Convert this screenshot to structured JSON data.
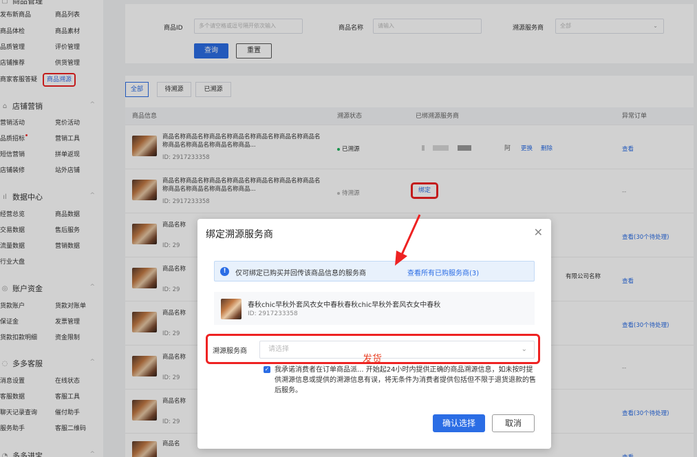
{
  "sidebar": {
    "s0": {
      "title": "商品管理",
      "items": [
        [
          "发布新商品",
          "商品列表"
        ],
        [
          "商品体检",
          "商品素材"
        ],
        [
          "品质管理",
          "评价管理"
        ],
        [
          "店铺推荐",
          "供货管理"
        ],
        [
          "商家客服答疑",
          "商品溯源"
        ]
      ]
    },
    "s1": {
      "title": "店铺营销",
      "items": [
        [
          "营销活动",
          "竞价活动"
        ],
        [
          "品质招标",
          "营销工具"
        ],
        [
          "短信营销",
          "拼单返现"
        ],
        [
          "店铺装修",
          "站外店铺"
        ]
      ]
    },
    "s2": {
      "title": "数据中心",
      "items": [
        [
          "经营总览",
          "商品数据"
        ],
        [
          "交易数据",
          "售后服务"
        ],
        [
          "流量数据",
          "营销数据"
        ],
        [
          "行业大盘",
          ""
        ]
      ]
    },
    "s3": {
      "title": "账户资金",
      "items": [
        [
          "货款账户",
          "货款对账单"
        ],
        [
          "保证金",
          "发票管理"
        ],
        [
          "货款扣款明细",
          "资金限制"
        ]
      ]
    },
    "s4": {
      "title": "多多客服",
      "items": [
        [
          "消息设置",
          "在线状态"
        ],
        [
          "客服数据",
          "客服工具"
        ],
        [
          "聊天记录查询",
          "催付助手"
        ],
        [
          "服务助手",
          "客服二维码"
        ]
      ]
    },
    "s5": {
      "title": "多多进宝"
    }
  },
  "filter": {
    "id_label": "商品ID",
    "id_placeholder": "多个请空格或逗号隔开依次输入",
    "name_label": "商品名称",
    "name_placeholder": "请输入",
    "svc_label": "溯源服务商",
    "svc_value": "全部",
    "search": "查询",
    "reset": "重置"
  },
  "tabs": [
    "全部",
    "待溯源",
    "已溯源"
  ],
  "table": {
    "headers": [
      "商品信息",
      "溯源状态",
      "已绑溯源服务商",
      "异常订单"
    ],
    "rows": [
      {
        "name": "商品名称商品名称商品名称商品名称商品名称商品名称商品名称商品名称商品名称商品名称商品...",
        "id": "ID: 2917233358",
        "status": "已溯源",
        "svc_change": "更换",
        "svc_delete": "删除",
        "op": "查看"
      },
      {
        "name": "商品名称商品名称商品名称商品名称商品名称商品名称商品名称商品名称商品名称商品名称商品...",
        "id": "ID: 2917233358",
        "status": "待溯源",
        "bind": "绑定",
        "op": "--"
      },
      {
        "name": "商品名称",
        "id": "ID: 29",
        "op": "查看(30个待处理)"
      },
      {
        "name": "商品名称",
        "id": "ID: 29",
        "svc": "有限公司名称",
        "op": "查看"
      },
      {
        "name": "商品名称",
        "id": "ID: 29",
        "op": "查看(30个待处理)"
      },
      {
        "name": "商品名称",
        "id": "ID: 29",
        "op": "--"
      },
      {
        "name": "商品名称",
        "id": "ID: 29",
        "op": "查看(30个待处理)"
      },
      {
        "name": "商品名",
        "id": "",
        "op": "查看"
      }
    ]
  },
  "modal": {
    "title": "绑定溯源服务商",
    "notice": "仅可绑定已购买并回传该商品信息的服务商",
    "notice_link": "查看所有已购服务商(3)",
    "product_name": "春秋chic早秋外套风衣女中春秋春秋chic早秋外套风衣女中春秋",
    "product_id": "ID: 2917233358",
    "svc_label": "溯源服务商",
    "svc_placeholder": "请选择",
    "agree_text": "我承诺消费者在订单商品派... 开始起24小时内提供正确的商品溯源信息，如未按时提供溯源信息或提供的溯源信息有误，将无条件为消费者提供包括但不限于退货退款的售后服务。",
    "annotation": "发货",
    "confirm": "确认选择",
    "cancel": "取消"
  },
  "colors": {
    "primary": "#2b6de5",
    "highlight": "#ee2222",
    "success": "#19b35b"
  }
}
